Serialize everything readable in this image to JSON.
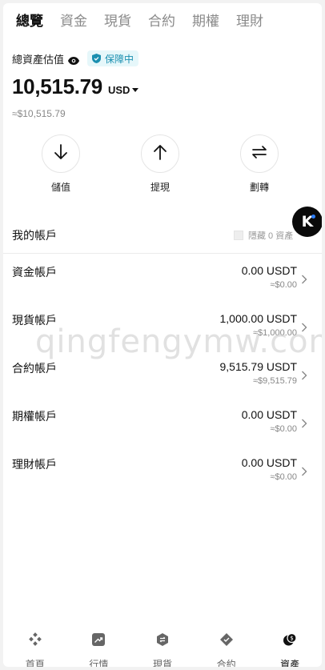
{
  "tabs": [
    {
      "label": "總覽",
      "active": true
    },
    {
      "label": "資金",
      "active": false
    },
    {
      "label": "現貨",
      "active": false
    },
    {
      "label": "合約",
      "active": false
    },
    {
      "label": "期權",
      "active": false
    },
    {
      "label": "理財",
      "active": false
    }
  ],
  "summary": {
    "label": "總資產估值",
    "badge": "保障中",
    "balance": "10,515.79",
    "currency": "USD",
    "approx": "≈$10,515.79"
  },
  "actions": [
    {
      "label": "儲值",
      "icon": "arrow-down-icon"
    },
    {
      "label": "提現",
      "icon": "arrow-up-icon"
    },
    {
      "label": "劃轉",
      "icon": "transfer-icon"
    }
  ],
  "accounts_header": {
    "title": "我的帳戶",
    "hide_zero_label": "隱藏 0 資產"
  },
  "accounts": [
    {
      "name": "資金帳戶",
      "amount": "0.00 USDT",
      "fiat": "≈$0.00"
    },
    {
      "name": "現貨帳戶",
      "amount": "1,000.00 USDT",
      "fiat": "≈$1,000.00"
    },
    {
      "name": "合約帳戶",
      "amount": "9,515.79 USDT",
      "fiat": "≈$9,515.79"
    },
    {
      "name": "期權帳戶",
      "amount": "0.00 USDT",
      "fiat": "≈$0.00"
    },
    {
      "name": "理財帳戶",
      "amount": "0.00 USDT",
      "fiat": "≈$0.00"
    }
  ],
  "floating_button": {
    "letter": "K"
  },
  "watermark": "qingfengymw.com",
  "bottom_nav": [
    {
      "label": "首頁",
      "icon": "home-icon",
      "active": false
    },
    {
      "label": "行情",
      "icon": "market-icon",
      "active": false
    },
    {
      "label": "現貨",
      "icon": "spot-icon",
      "active": false
    },
    {
      "label": "合約",
      "icon": "futures-icon",
      "active": false
    },
    {
      "label": "資產",
      "icon": "assets-icon",
      "active": true
    }
  ],
  "colors": {
    "badge_bg": "#e6f7fa",
    "badge_text": "#1a8fb0",
    "accent_dot": "#2f80ff"
  }
}
